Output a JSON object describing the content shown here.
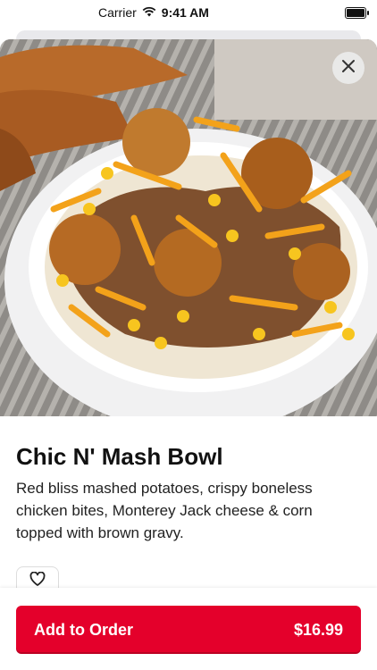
{
  "status_bar": {
    "carrier": "Carrier",
    "time": "9:41 AM",
    "icons": [
      "wifi-icon",
      "battery-icon"
    ]
  },
  "product": {
    "title": "Chic N' Mash Bowl",
    "description": "Red bliss mashed potatoes, crispy boneless chicken bites, Monterey Jack cheese & corn topped with brown gravy.",
    "image_icon": "food-bowl-image"
  },
  "actions": {
    "close_icon": "close-icon",
    "favorite_icon": "heart-icon",
    "add_label": "Add to Order",
    "price": "$16.99"
  },
  "colors": {
    "accent": "#e4002b",
    "background": "#ffffff"
  }
}
